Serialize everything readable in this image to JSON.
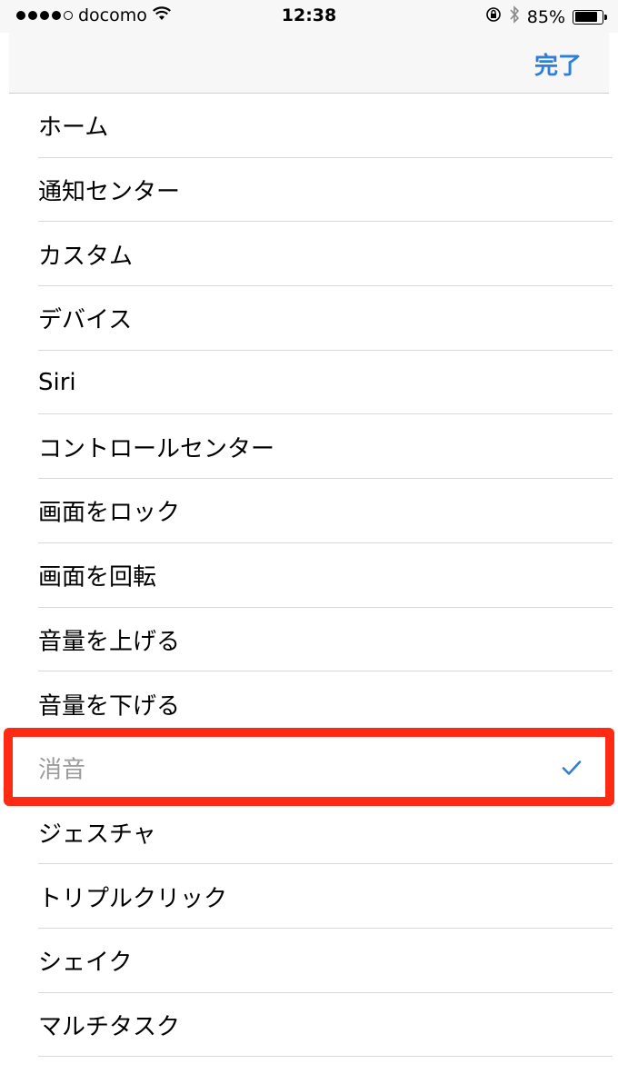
{
  "status_bar": {
    "carrier": "docomo",
    "time": "12:38",
    "battery_percent": "85%",
    "battery_level": 0.85,
    "signal_bars_filled": 4,
    "signal_bars_total": 5,
    "icons": [
      "wifi-icon",
      "orientation-lock-icon",
      "bluetooth-icon",
      "battery-icon"
    ]
  },
  "nav": {
    "done_label": "完了",
    "accent_color": "#2f7fd6"
  },
  "list": {
    "items": [
      {
        "label": "ホーム"
      },
      {
        "label": "通知センター"
      },
      {
        "label": "カスタム"
      },
      {
        "label": "デバイス"
      },
      {
        "label": "Siri"
      },
      {
        "label": "コントロールセンター"
      },
      {
        "label": "画面をロック"
      },
      {
        "label": "画面を回転"
      },
      {
        "label": "音量を上げる"
      },
      {
        "label": "音量を下げる"
      },
      {
        "label": "消音",
        "selected": true
      },
      {
        "label": "ジェスチャ"
      },
      {
        "label": "トリプルクリック"
      },
      {
        "label": "シェイク"
      },
      {
        "label": "マルチタスク"
      }
    ],
    "selected_label": "消音",
    "checkmark_icon": "checkmark-icon"
  },
  "annotation": {
    "highlight_color": "#ff2a14"
  }
}
